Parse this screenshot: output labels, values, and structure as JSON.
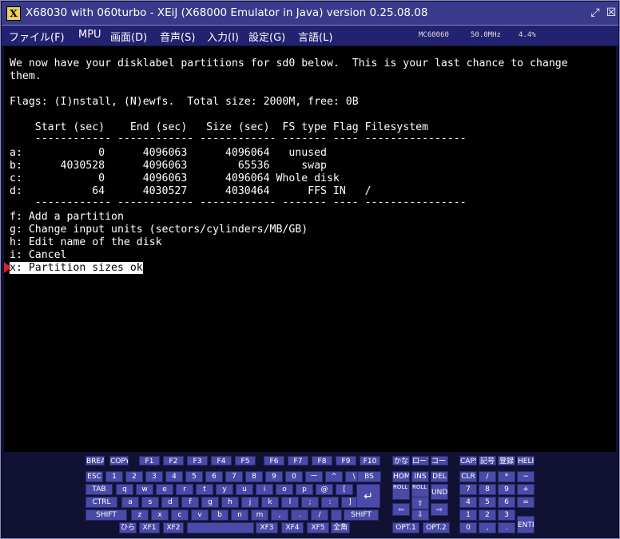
{
  "titlebar": {
    "icon": "xeij-app-icon",
    "title": "X68030 with 060turbo - XEiJ (X68000 Emulator in Java) version 0.25.08.08",
    "restore_icon": "restore-icon",
    "close_icon": "close-icon"
  },
  "menubar": {
    "items": [
      "ファイル(F)",
      "MPU",
      "画面(D)",
      "音声(S)",
      "入力(I)",
      "設定(G)",
      "言語(L)"
    ],
    "status": {
      "cpu": "MC68060",
      "clock": "50.0MHz",
      "load": "4.4%"
    }
  },
  "terminal": {
    "lines": [
      "We now have your disklabel partitions for sd0 below.  This is your last chance to change",
      "them.",
      "",
      "Flags: (I)nstall, (N)ewfs.  Total size: 2000M, free: 0B",
      "",
      "    Start (sec)    End (sec)   Size (sec)  FS type Flag Filesystem",
      "    ------------ ------------ ------------ ------- ---- ----------------",
      "a:            0      4096063      4096064   unused",
      "b:      4030528      4096063        65536     swap",
      "c:            0      4096063      4096064 Whole disk",
      "d:           64      4030527      4030464      FFS IN   /",
      "    ------------ ------------ ------------ ------- ---- ----------------",
      "f: Add a partition",
      "g: Change input units (sectors/cylinders/MB/GB)",
      "h: Edit name of the disk",
      "i: Cancel",
      "x: Partition sizes ok"
    ]
  },
  "keyboard": {
    "keys": [
      "BREAK",
      "COPY",
      "F1",
      "F2",
      "F3",
      "F4",
      "F5",
      "F6",
      "F7",
      "F8",
      "F9",
      "F10",
      "かな",
      "ローマ",
      "コード",
      "CAPS",
      "記号",
      "登録",
      "HELP",
      "ESC",
      "1",
      "2",
      "3",
      "4",
      "5",
      "6",
      "7",
      "8",
      "9",
      "0",
      "ー",
      "^",
      "\\",
      "BS",
      "HOME",
      "INS",
      "DEL",
      "CLR",
      "/",
      "*",
      "−",
      "TAB",
      "q",
      "w",
      "e",
      "r",
      "t",
      "y",
      "u",
      "i",
      "o",
      "p",
      "@",
      "[",
      "ROLL UP",
      "ROLL DOWN",
      "UNDO",
      "7",
      "8",
      "9",
      "+",
      "CTRL",
      "a",
      "s",
      "d",
      "f",
      "g",
      "h",
      "j",
      "k",
      "l",
      ";",
      ":",
      "]",
      "⇦",
      "⇧",
      "⇨",
      "4",
      "5",
      "6",
      "=",
      "SHIFT",
      "z",
      "x",
      "c",
      "v",
      "b",
      "n",
      "m",
      ",",
      ".",
      "/",
      "",
      "SHIFT",
      "⇩",
      "1",
      "2",
      "3",
      "ひら",
      "XF1",
      "XF2",
      "",
      "XF3",
      "XF4",
      "XF5",
      "全角",
      "OPT.1",
      "OPT.2",
      "0",
      ",",
      ".",
      "ENTER"
    ]
  }
}
